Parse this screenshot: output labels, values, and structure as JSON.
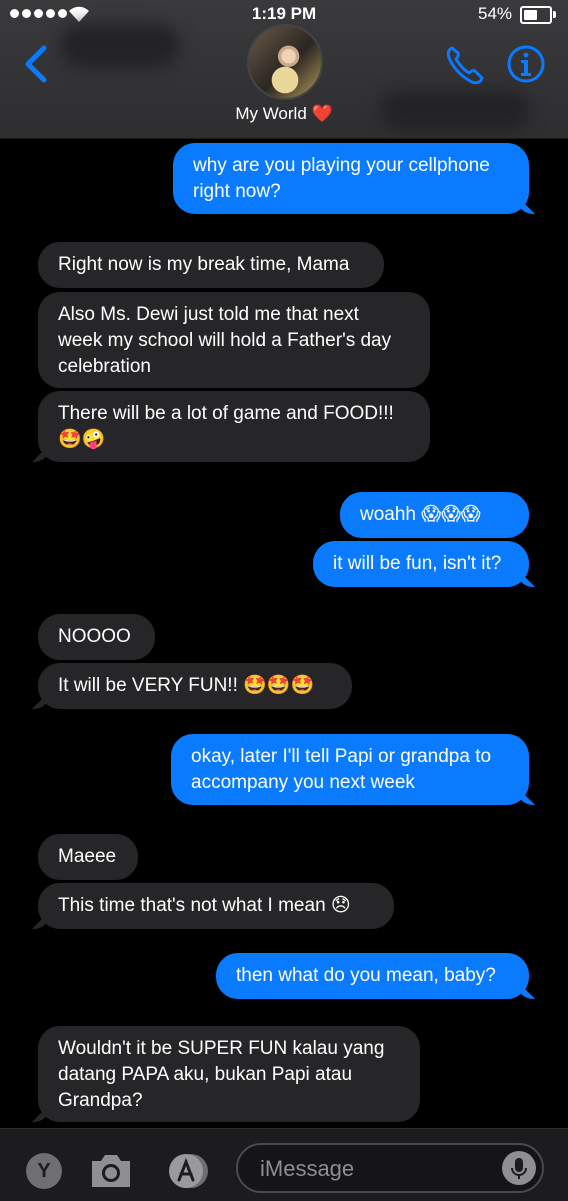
{
  "status_bar": {
    "time": "1:19 PM",
    "battery": "54%"
  },
  "header": {
    "contact_name": "My World ❤️"
  },
  "messages": [
    {
      "direction": "out",
      "lines": [
        "why are you playing your cellphone",
        "right now?"
      ]
    },
    {
      "direction": "in",
      "lines": [
        "Right now is my break time, Mama"
      ]
    },
    {
      "direction": "in",
      "lines": [
        "Also Ms. Dewi just told me that next",
        "week my school will hold a Father's day",
        "celebration"
      ]
    },
    {
      "direction": "in",
      "lines": [
        "There will be a lot of game and FOOD!!!",
        "🤩🤪"
      ]
    },
    {
      "direction": "out",
      "lines": [
        "woahh 😱😱😱"
      ]
    },
    {
      "direction": "out",
      "lines": [
        "it will be fun, isn't it?"
      ]
    },
    {
      "direction": "in",
      "lines": [
        "NOOOO"
      ]
    },
    {
      "direction": "in",
      "lines": [
        "It will be VERY FUN!! 🤩🤩🤩"
      ]
    },
    {
      "direction": "out",
      "lines": [
        "okay, later I'll tell Papi or grandpa to",
        "accompany you next week"
      ]
    },
    {
      "direction": "in",
      "lines": [
        "Maeee"
      ]
    },
    {
      "direction": "in",
      "lines": [
        "This time that's not what I mean 😞"
      ]
    },
    {
      "direction": "out",
      "lines": [
        "then what do you mean, baby?"
      ]
    },
    {
      "direction": "in",
      "lines": [
        "Wouldn't it be SUPER FUN kalau yang",
        "datang PAPA aku, bukan Papi atau",
        "Grandpa?"
      ]
    }
  ],
  "input_bar": {
    "placeholder": "iMessage",
    "apps_button": "Y"
  },
  "colors": {
    "outgoing": "#0a7aff",
    "incoming": "#262628",
    "accent": "#0a7aff"
  },
  "icons": [
    "back-chevron-icon",
    "phone-icon",
    "info-icon",
    "camera-icon",
    "app-store-icon",
    "microphone-icon"
  ]
}
